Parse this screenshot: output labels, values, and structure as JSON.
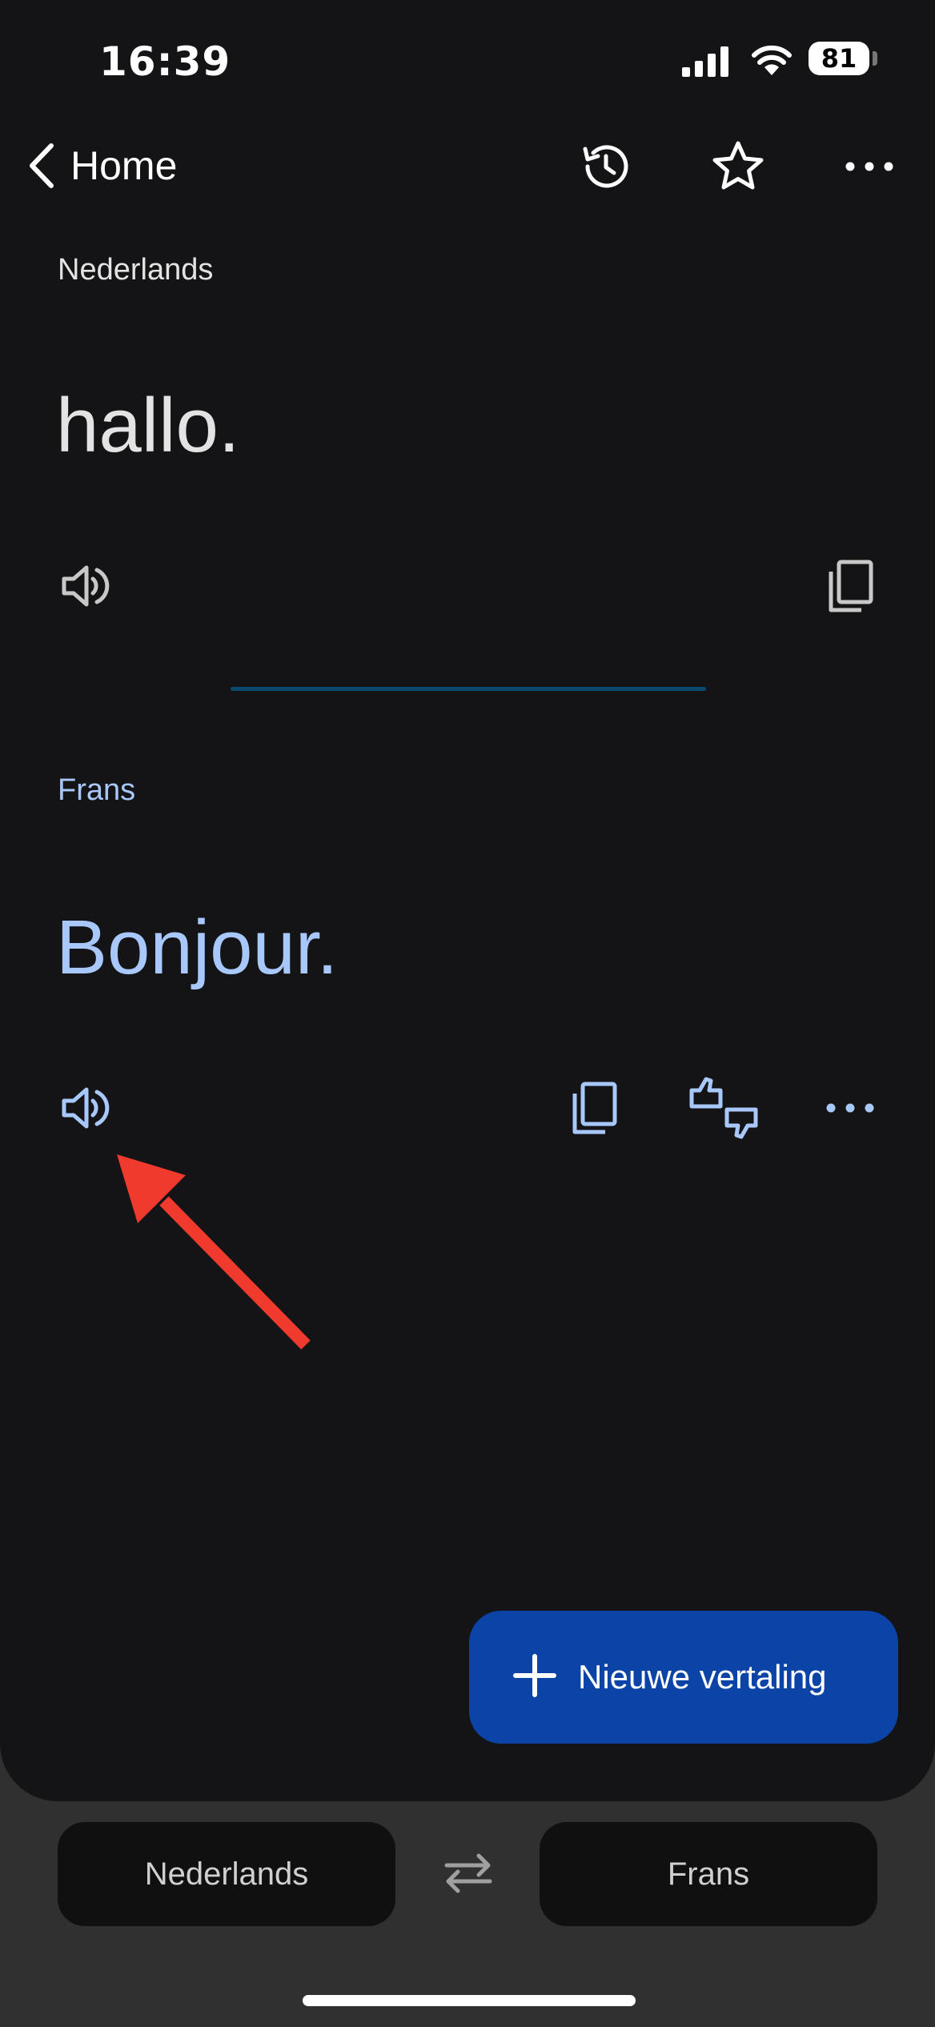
{
  "status_bar": {
    "time": "16:39",
    "battery": "81"
  },
  "nav": {
    "back_label": "Home"
  },
  "source": {
    "language": "Nederlands",
    "text": "hallo."
  },
  "target": {
    "language": "Frans",
    "text": "Bonjour."
  },
  "fab": {
    "label": "Nieuwe vertaling"
  },
  "bottom_bar": {
    "source_language": "Nederlands",
    "target_language": "Frans"
  },
  "icons": [
    "chevron-left-icon",
    "history-icon",
    "star-icon",
    "more-icon",
    "speaker-icon",
    "copy-icon",
    "feedback-icon",
    "plus-icon",
    "swap-icon"
  ],
  "colors": {
    "accent_text": "#a8c7fa",
    "fab": "#0b44a6",
    "annotation_arrow": "#f03a2e"
  }
}
